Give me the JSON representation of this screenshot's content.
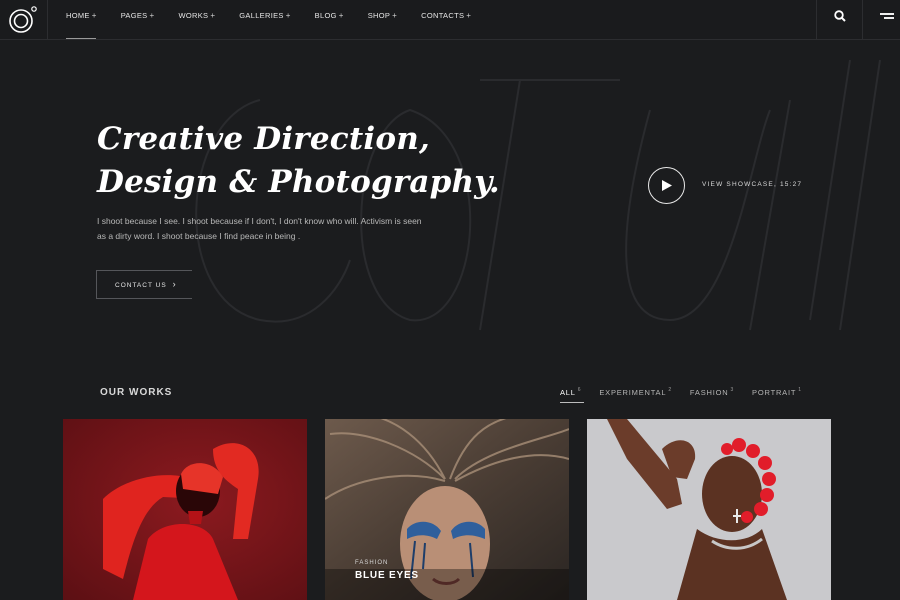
{
  "header": {
    "nav": [
      {
        "label": "HOME"
      },
      {
        "label": "PAGES"
      },
      {
        "label": "WORKS"
      },
      {
        "label": "GALLERIES"
      },
      {
        "label": "BLOG"
      },
      {
        "label": "SHOP"
      },
      {
        "label": "CONTACTS"
      }
    ],
    "active_nav": "HOME",
    "icons": {
      "logo": "circle-logo-icon",
      "search": "search-icon",
      "menu": "hamburger-icon"
    }
  },
  "hero": {
    "title_line1": "Creative Direction,",
    "title_line2": "Design & Photography.",
    "description": "I shoot because I see. I shoot because if I don't, I don't know who will. Activism is seen as a dirty word. I shoot because I find peace in being .",
    "contact_button": "CONTACT US",
    "showcase_label": "VIEW SHOWCASE, 15:27"
  },
  "works": {
    "heading": "OUR WORKS",
    "filters": [
      {
        "label": "ALL",
        "count": "6",
        "active": true
      },
      {
        "label": "EXPERIMENTAL",
        "count": "2",
        "active": false
      },
      {
        "label": "FASHION",
        "count": "3",
        "active": false
      },
      {
        "label": "PORTRAIT",
        "count": "1",
        "active": false
      }
    ],
    "cards": [
      {
        "category": "",
        "title": ""
      },
      {
        "category": "FASHION",
        "title": "BLUE EYES"
      },
      {
        "category": "",
        "title": ""
      }
    ]
  },
  "colors": {
    "background": "#1b1c1e",
    "text": "#ffffff",
    "card1_tint": "#b0151c",
    "card3_background": "#c9c9cc"
  }
}
